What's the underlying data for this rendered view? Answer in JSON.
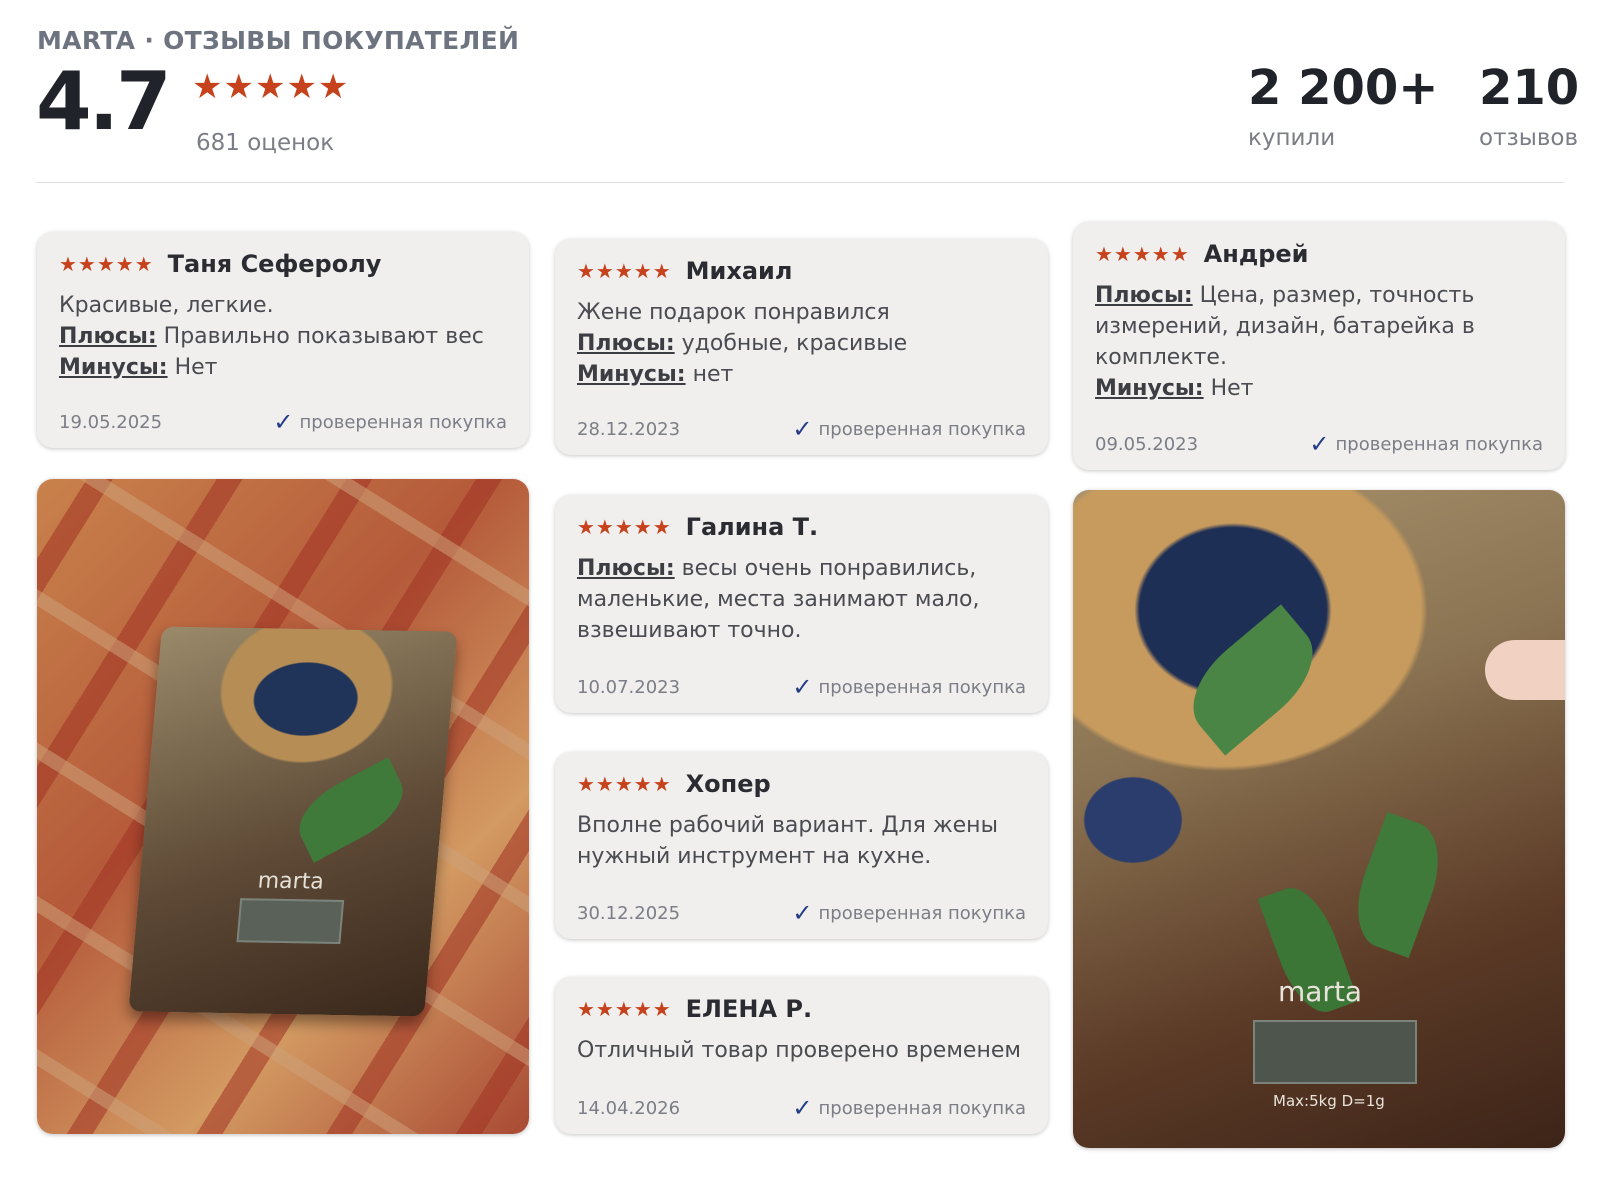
{
  "header": {
    "brand": "MARTA · ОТЗЫВЫ ПОКУПАТЕЛЕЙ",
    "rating": "4.7",
    "stars": "★★★★★",
    "rating_count": "681 оценок",
    "bought_num": "2 200+",
    "bought_label": "купили",
    "reviews_num": "210",
    "reviews_label": "отзывов"
  },
  "common": {
    "stars": "★★★★★",
    "check": "✓",
    "verified": "проверенная покупка"
  },
  "reviews": [
    {
      "author": "Таня Сеферолу",
      "text": "Красивые, легкие.",
      "pros_label": "Плюсы:",
      "pros": " Правильно показывают вес",
      "cons_label": "Минусы:",
      "cons": " Нет",
      "date": "19.05.2025"
    },
    {
      "author": "Михаил",
      "text": "Жене подарок понравился",
      "pros_label": "Плюсы:",
      "pros": " удобные, красивые",
      "cons_label": "Минусы:",
      "cons": " нет",
      "date": "28.12.2023"
    },
    {
      "author": "Андрей",
      "pros_label": "Плюсы:",
      "pros": " Цена, размер, точность измерений, дизайн, батарейка в комплекте.",
      "cons_label": "Минусы:",
      "cons": " Нет",
      "date": "09.05.2023"
    },
    {
      "author": "Галина Т.",
      "pros_label": "Плюсы:",
      "pros": " весы очень понравились, маленькие, места занимают мало, взвешивают точно.",
      "date": "10.07.2023"
    },
    {
      "author": "Хопер",
      "text": "Вполне рабочий вариант. Для жены нужный инструмент на кухне.",
      "date": "30.12.2025"
    },
    {
      "author": "ЕЛЕНА Р.",
      "text": "Отличный товар проверено временем",
      "date": "14.04.2026"
    }
  ],
  "photos": {
    "logo_text": "marta",
    "max_label": "Max:5kg D=1g"
  }
}
